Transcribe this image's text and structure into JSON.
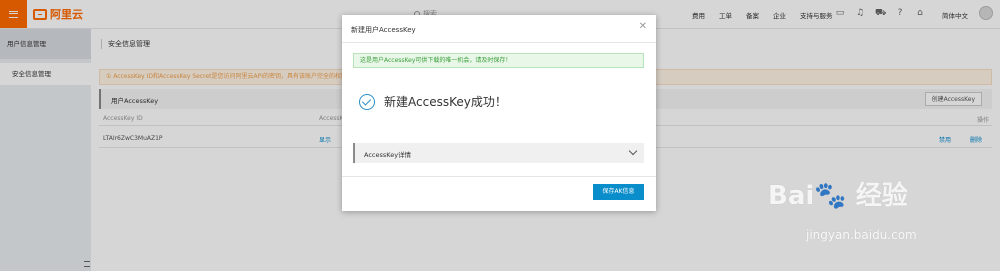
{
  "topbar": {
    "logo_text": "阿里云",
    "search_placeholder": "搜索",
    "nav": [
      "费用",
      "工单",
      "备案",
      "企业",
      "支持与服务"
    ],
    "language": "简体中文",
    "icons": [
      "screen-icon",
      "bell-icon",
      "cart-icon",
      "help-icon",
      "home-icon"
    ]
  },
  "sidebar": {
    "title": "用户信息管理",
    "items": [
      {
        "label": "安全信息管理"
      }
    ]
  },
  "main": {
    "page_title": "安全信息管理",
    "alert": "① AccessKey ID和AccessKey Secret是您访问阿里云API的密钥，具有该账户完全的权限，请您妥善保管。",
    "tab_label": "用户AccessKey",
    "create_button": "创建AccessKey",
    "columns": [
      "AccessKey ID",
      "AccessKey Secret",
      "操作"
    ],
    "row": {
      "id": "LTAIr6ZwC3MuAZ1P",
      "secret": "显示",
      "action_disable": "禁用",
      "action_delete": "删除"
    }
  },
  "modal": {
    "title": "新建用户AccessKey",
    "notice": "这是用户AccessKey可供下载的唯一机会，请及时保存！",
    "success_text": "新建AccessKey成功！",
    "details_label": "AccessKey详情",
    "save_button": "保存AK信息"
  },
  "colors": {
    "brand": "#ff6a00",
    "primary_button": "#0a8dcb",
    "success": "#39a039",
    "warning": "#f0a04b"
  }
}
